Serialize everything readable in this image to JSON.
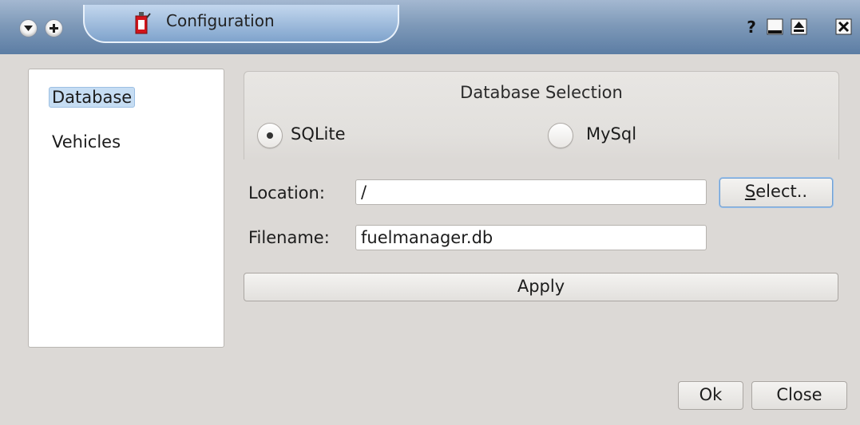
{
  "window": {
    "title": "Configuration"
  },
  "sidebar": {
    "items": [
      {
        "label": "Database",
        "selected": true
      },
      {
        "label": "Vehicles",
        "selected": false
      }
    ]
  },
  "database_selection": {
    "title": "Database Selection",
    "options": [
      {
        "label": "SQLite",
        "checked": true
      },
      {
        "label": "MySql",
        "checked": false
      }
    ]
  },
  "form": {
    "location_label": "Location:",
    "location_value": "/",
    "select_button": {
      "mnemonic": "S",
      "rest": "elect.."
    },
    "filename_label": "Filename:",
    "filename_value": "fuelmanager.db",
    "apply_label": "Apply"
  },
  "footer": {
    "ok_label": "Ok",
    "close_label": "Close"
  },
  "icons": {
    "window_menu": "chevron-down-icon",
    "keep_above": "plus-icon",
    "app": "fuel-can-icon",
    "help": "help-icon",
    "minimize": "minimize-icon",
    "maximize": "maximize-icon",
    "close": "close-icon"
  },
  "colors": {
    "titlebar": "#7f9ab9",
    "selection": "#c6ddf3",
    "focus_border": "#6f9fd3",
    "app_icon_red": "#d2141b"
  }
}
